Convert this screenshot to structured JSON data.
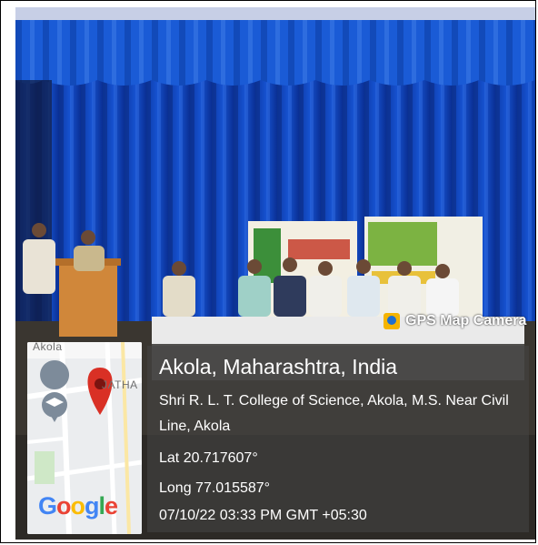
{
  "image": {
    "description_free": true
  },
  "camera_app": {
    "badge_label": "GPS Map Camera",
    "badge_icon": "camera-pin-icon"
  },
  "map": {
    "place_label": "Akola",
    "area_label": "JATHA",
    "logo_text": "Google",
    "logo_colors": [
      "#4285F4",
      "#EA4335",
      "#FBBC05",
      "#4285F4",
      "#34A853",
      "#EA4335"
    ],
    "pin_color": "#d93025",
    "marker_icon": "graduation-cap-icon"
  },
  "location": {
    "title": "Akola, Maharashtra, India",
    "address_line1": "Shri R. L. T. College of Science, Akola, M.S. Near Civil",
    "address_line2": "Line, Akola",
    "latitude": "Lat 20.717607°",
    "longitude": "Long 77.015587°",
    "datetime": "07/10/22 03:33 PM GMT +05:30"
  }
}
